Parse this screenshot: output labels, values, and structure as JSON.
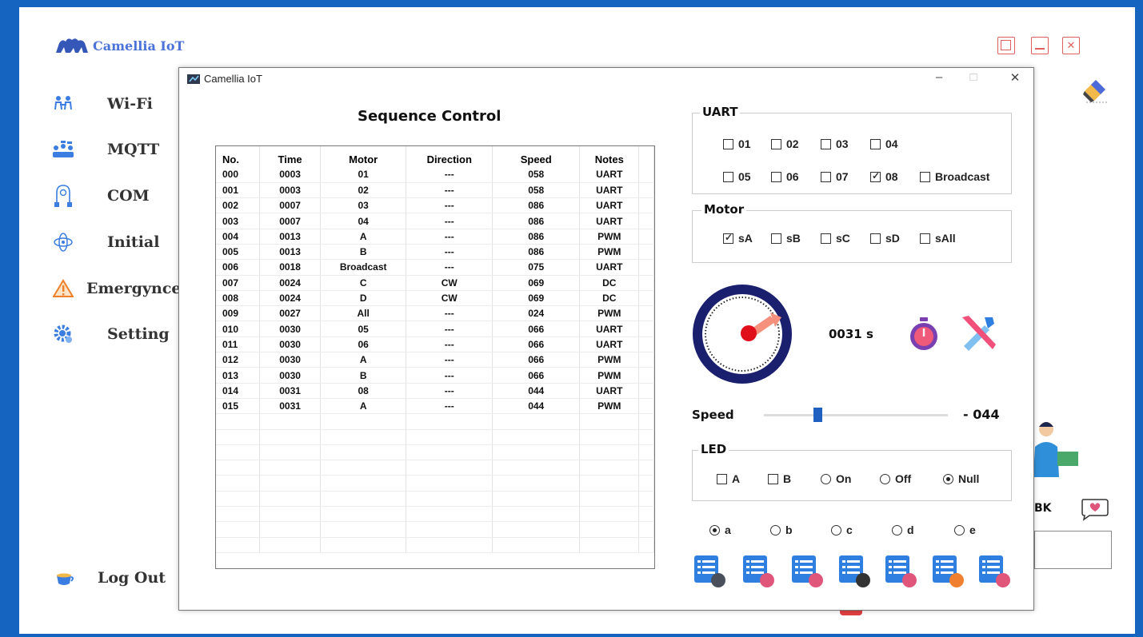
{
  "app": {
    "brand": "Camellia IoT"
  },
  "sidebar": {
    "items": [
      {
        "label": "Wi-Fi",
        "icon": "wifi-people-icon"
      },
      {
        "label": "MQTT",
        "icon": "mqtt-people-icon"
      },
      {
        "label": "COM",
        "icon": "com-plug-icon"
      },
      {
        "label": "Initial",
        "icon": "initial-network-icon"
      },
      {
        "label": "Emergynce",
        "icon": "warning-icon"
      },
      {
        "label": "Setting",
        "icon": "gear-icon"
      }
    ],
    "logout": "Log Out"
  },
  "background_right": {
    "label": "BK"
  },
  "window": {
    "title": "Camellia IoT",
    "controls": {
      "minimize": "–",
      "maximize": "□",
      "close": "✕"
    }
  },
  "sequence": {
    "title": "Sequence Control",
    "columns": [
      "No.",
      "Time",
      "Motor",
      "Direction",
      "Speed",
      "Notes"
    ],
    "rows": [
      [
        "000",
        "0003",
        "01",
        "---",
        "058",
        "UART"
      ],
      [
        "001",
        "0003",
        "02",
        "---",
        "058",
        "UART"
      ],
      [
        "002",
        "0007",
        "03",
        "---",
        "086",
        "UART"
      ],
      [
        "003",
        "0007",
        "04",
        "---",
        "086",
        "UART"
      ],
      [
        "004",
        "0013",
        "A",
        "---",
        "086",
        "PWM"
      ],
      [
        "005",
        "0013",
        "B",
        "---",
        "086",
        "PWM"
      ],
      [
        "006",
        "0018",
        "Broadcast",
        "---",
        "075",
        "UART"
      ],
      [
        "007",
        "0024",
        "C",
        "CW",
        "069",
        "DC"
      ],
      [
        "008",
        "0024",
        "D",
        "CW",
        "069",
        "DC"
      ],
      [
        "009",
        "0027",
        "All",
        "---",
        "024",
        "PWM"
      ],
      [
        "010",
        "0030",
        "05",
        "---",
        "066",
        "UART"
      ],
      [
        "011",
        "0030",
        "06",
        "---",
        "066",
        "UART"
      ],
      [
        "012",
        "0030",
        "A",
        "---",
        "066",
        "PWM"
      ],
      [
        "013",
        "0030",
        "B",
        "---",
        "066",
        "PWM"
      ],
      [
        "014",
        "0031",
        "08",
        "---",
        "044",
        "UART"
      ],
      [
        "015",
        "0031",
        "A",
        "---",
        "044",
        "PWM"
      ]
    ]
  },
  "uart": {
    "title": "UART",
    "options": [
      {
        "label": "01",
        "checked": false
      },
      {
        "label": "02",
        "checked": false
      },
      {
        "label": "03",
        "checked": false
      },
      {
        "label": "04",
        "checked": false
      },
      {
        "label": "05",
        "checked": false
      },
      {
        "label": "06",
        "checked": false
      },
      {
        "label": "07",
        "checked": false
      },
      {
        "label": "08",
        "checked": true
      },
      {
        "label": "Broadcast",
        "checked": false
      }
    ]
  },
  "motor": {
    "title": "Motor",
    "options": [
      {
        "label": "sA",
        "checked": true
      },
      {
        "label": "sB",
        "checked": false
      },
      {
        "label": "sC",
        "checked": false
      },
      {
        "label": "sD",
        "checked": false
      },
      {
        "label": "sAll",
        "checked": false
      }
    ]
  },
  "timer": {
    "value": "0031 s"
  },
  "speed": {
    "label": "Speed",
    "value": "- 044",
    "slider_fraction": 0.29
  },
  "led": {
    "title": "LED",
    "checks": [
      {
        "label": "A",
        "checked": false
      },
      {
        "label": "B",
        "checked": false
      }
    ],
    "radios": [
      {
        "label": "On",
        "selected": false
      },
      {
        "label": "Off",
        "selected": false
      },
      {
        "label": "Null",
        "selected": true
      }
    ]
  },
  "modes": [
    {
      "label": "a",
      "selected": true
    },
    {
      "label": "b",
      "selected": false
    },
    {
      "label": "c",
      "selected": false
    },
    {
      "label": "d",
      "selected": false
    },
    {
      "label": "e",
      "selected": false
    }
  ],
  "toolbar": [
    {
      "icon": "list-add-icon",
      "accent": "#4a4f5c"
    },
    {
      "icon": "list-remove-icon",
      "accent": "#e0557a"
    },
    {
      "icon": "list-clear-icon",
      "accent": "#e0557a"
    },
    {
      "icon": "list-edit-icon",
      "accent": "#333333"
    },
    {
      "icon": "list-save-icon",
      "accent": "#e0557a"
    },
    {
      "icon": "list-reload-icon",
      "accent": "#f08030"
    },
    {
      "icon": "list-run-icon",
      "accent": "#e0557a"
    }
  ],
  "colors": {
    "frame": "#1565c0",
    "list_icon": "#2f7fe0",
    "gauge_ring": "#1a1f6e",
    "needle": "#e0101a"
  }
}
